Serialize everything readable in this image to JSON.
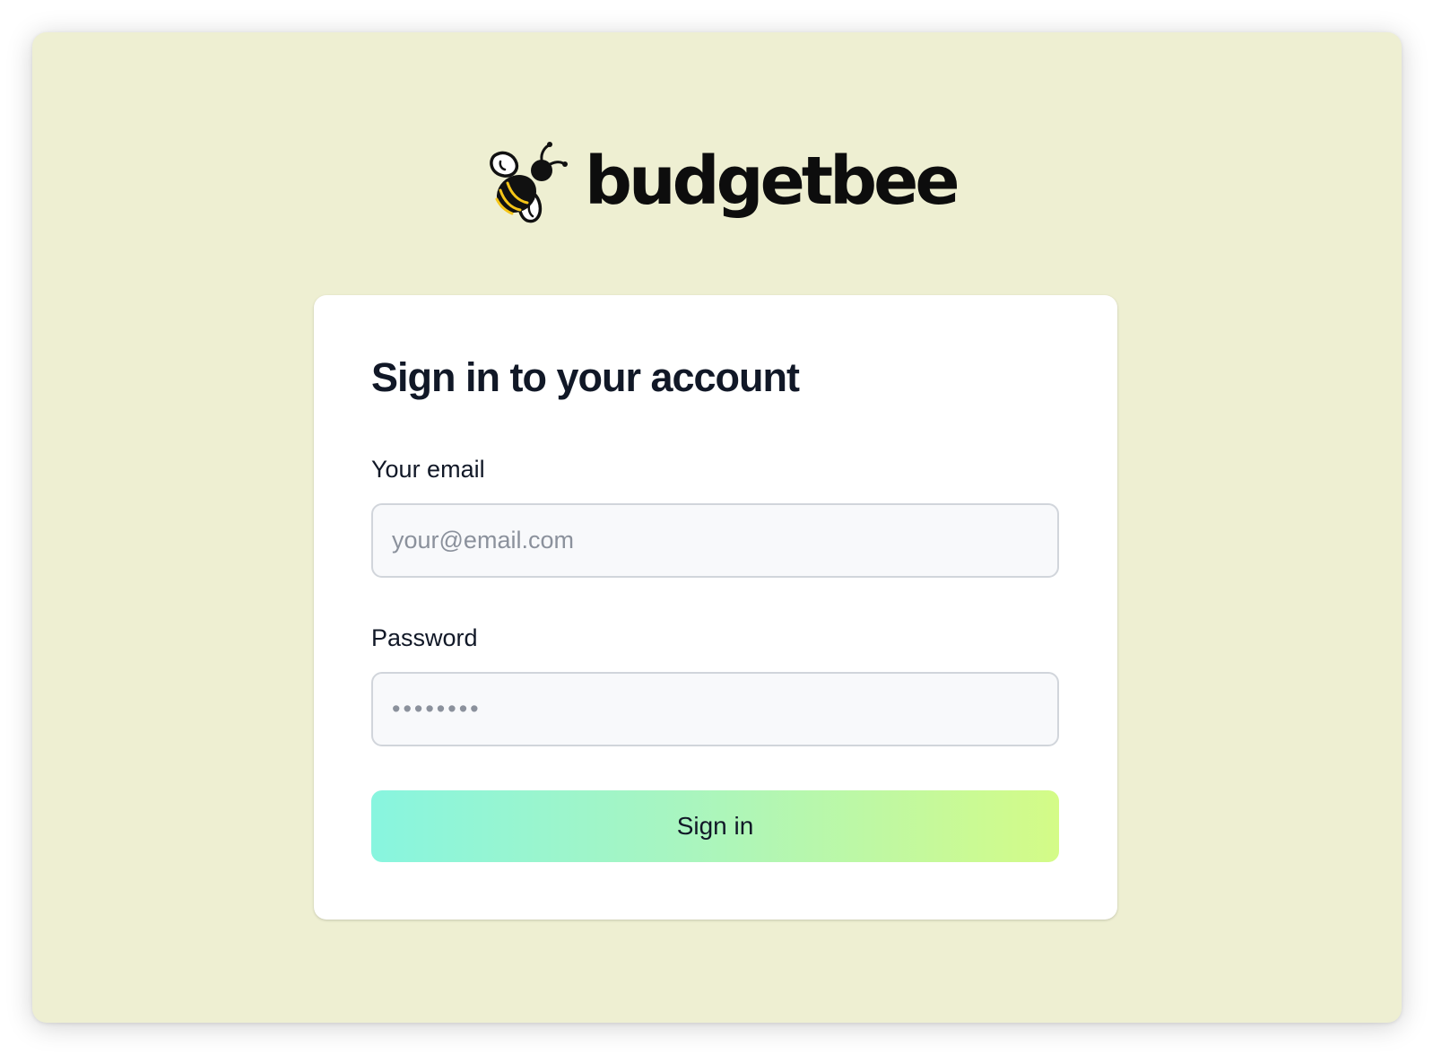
{
  "brand": {
    "name": "budgetbee",
    "logo_icon": "bee-icon"
  },
  "login": {
    "title": "Sign in to your account",
    "email": {
      "label": "Your email",
      "value": "",
      "placeholder": "your@email.com"
    },
    "password": {
      "label": "Password",
      "value": "",
      "placeholder": "••••••••"
    },
    "submit_label": "Sign in"
  },
  "colors": {
    "background": "#eeefd2",
    "card": "#ffffff",
    "button_gradient_start": "#88f5df",
    "button_gradient_end": "#d4fb87",
    "bee_stripe": "#f5c518"
  }
}
